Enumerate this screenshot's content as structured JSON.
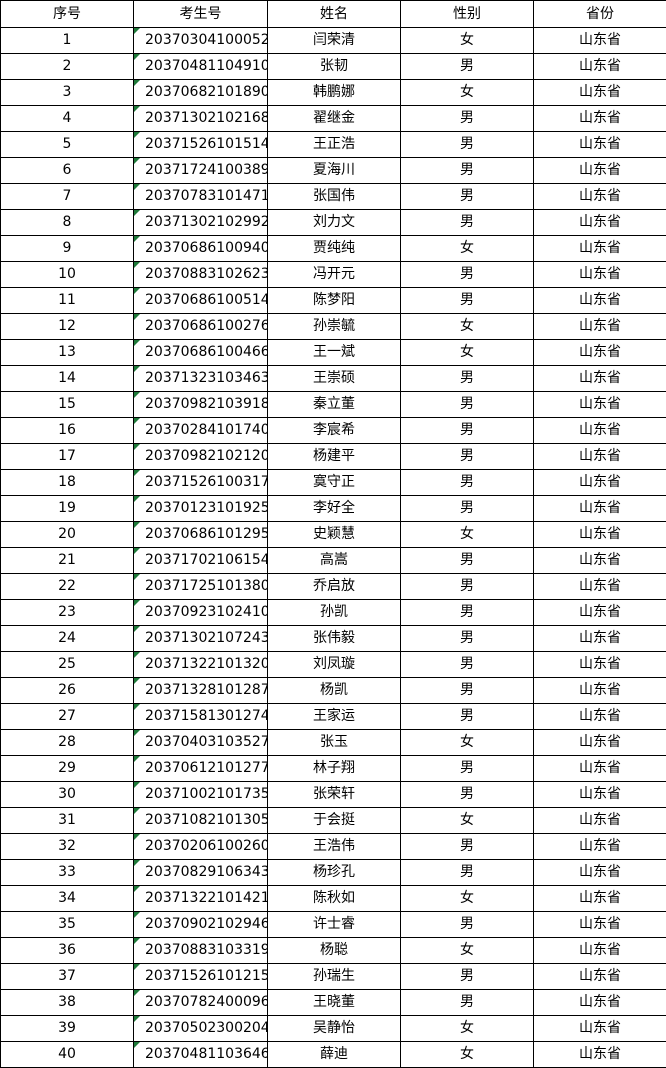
{
  "table": {
    "headers": [
      "序号",
      "考生号",
      "姓名",
      "性别",
      "省份"
    ],
    "rows": [
      [
        "1",
        "20370304100052",
        "闫荣清",
        "女",
        "山东省"
      ],
      [
        "2",
        "20370481104910",
        "张韧",
        "男",
        "山东省"
      ],
      [
        "3",
        "20370682101890",
        "韩鹏娜",
        "女",
        "山东省"
      ],
      [
        "4",
        "20371302102168",
        "翟继金",
        "男",
        "山东省"
      ],
      [
        "5",
        "20371526101514",
        "王正浩",
        "男",
        "山东省"
      ],
      [
        "6",
        "20371724100389",
        "夏海川",
        "男",
        "山东省"
      ],
      [
        "7",
        "20370783101471",
        "张国伟",
        "男",
        "山东省"
      ],
      [
        "8",
        "20371302102992",
        "刘力文",
        "男",
        "山东省"
      ],
      [
        "9",
        "20370686100940",
        "贾纯纯",
        "女",
        "山东省"
      ],
      [
        "10",
        "20370883102623",
        "冯开元",
        "男",
        "山东省"
      ],
      [
        "11",
        "20370686100514",
        "陈梦阳",
        "男",
        "山东省"
      ],
      [
        "12",
        "20370686100276",
        "孙崇毓",
        "女",
        "山东省"
      ],
      [
        "13",
        "20370686100466",
        "王一斌",
        "女",
        "山东省"
      ],
      [
        "14",
        "20371323103463",
        "王崇硕",
        "男",
        "山东省"
      ],
      [
        "15",
        "20370982103918",
        "秦立董",
        "男",
        "山东省"
      ],
      [
        "16",
        "20370284101740",
        "李宸希",
        "男",
        "山东省"
      ],
      [
        "17",
        "20370982102120",
        "杨建平",
        "男",
        "山东省"
      ],
      [
        "18",
        "20371526100317",
        "寞守正",
        "男",
        "山东省"
      ],
      [
        "19",
        "20370123101925",
        "李好全",
        "男",
        "山东省"
      ],
      [
        "20",
        "20370686101295",
        "史颖慧",
        "女",
        "山东省"
      ],
      [
        "21",
        "20371702106154",
        "高嵩",
        "男",
        "山东省"
      ],
      [
        "22",
        "20371725101380",
        "乔启放",
        "男",
        "山东省"
      ],
      [
        "23",
        "20370923102410",
        "孙凯",
        "男",
        "山东省"
      ],
      [
        "24",
        "20371302107243",
        "张伟毅",
        "男",
        "山东省"
      ],
      [
        "25",
        "20371322101320",
        "刘凤璇",
        "男",
        "山东省"
      ],
      [
        "26",
        "20371328101287",
        "杨凯",
        "男",
        "山东省"
      ],
      [
        "27",
        "20371581301274",
        "王家运",
        "男",
        "山东省"
      ],
      [
        "28",
        "20370403103527",
        "张玉",
        "女",
        "山东省"
      ],
      [
        "29",
        "20370612101277",
        "林子翔",
        "男",
        "山东省"
      ],
      [
        "30",
        "20371002101735",
        "张荣轩",
        "男",
        "山东省"
      ],
      [
        "31",
        "20371082101305",
        "于会挺",
        "女",
        "山东省"
      ],
      [
        "32",
        "20370206100260",
        "王浩伟",
        "男",
        "山东省"
      ],
      [
        "33",
        "20370829106343",
        "杨珍孔",
        "男",
        "山东省"
      ],
      [
        "34",
        "20371322101421",
        "陈秋如",
        "女",
        "山东省"
      ],
      [
        "35",
        "20370902102946",
        "许士睿",
        "男",
        "山东省"
      ],
      [
        "36",
        "20370883103319",
        "杨聪",
        "女",
        "山东省"
      ],
      [
        "37",
        "20371526101215",
        "孙瑞生",
        "男",
        "山东省"
      ],
      [
        "38",
        "20370782400096",
        "王晓董",
        "男",
        "山东省"
      ],
      [
        "39",
        "20370502300204",
        "吴静怡",
        "女",
        "山东省"
      ],
      [
        "40",
        "20370481103646",
        "薛迪",
        "女",
        "山东省"
      ]
    ]
  },
  "colors": {
    "border": "#000000",
    "text": "#000000",
    "indicator": "#1f7a3a"
  }
}
